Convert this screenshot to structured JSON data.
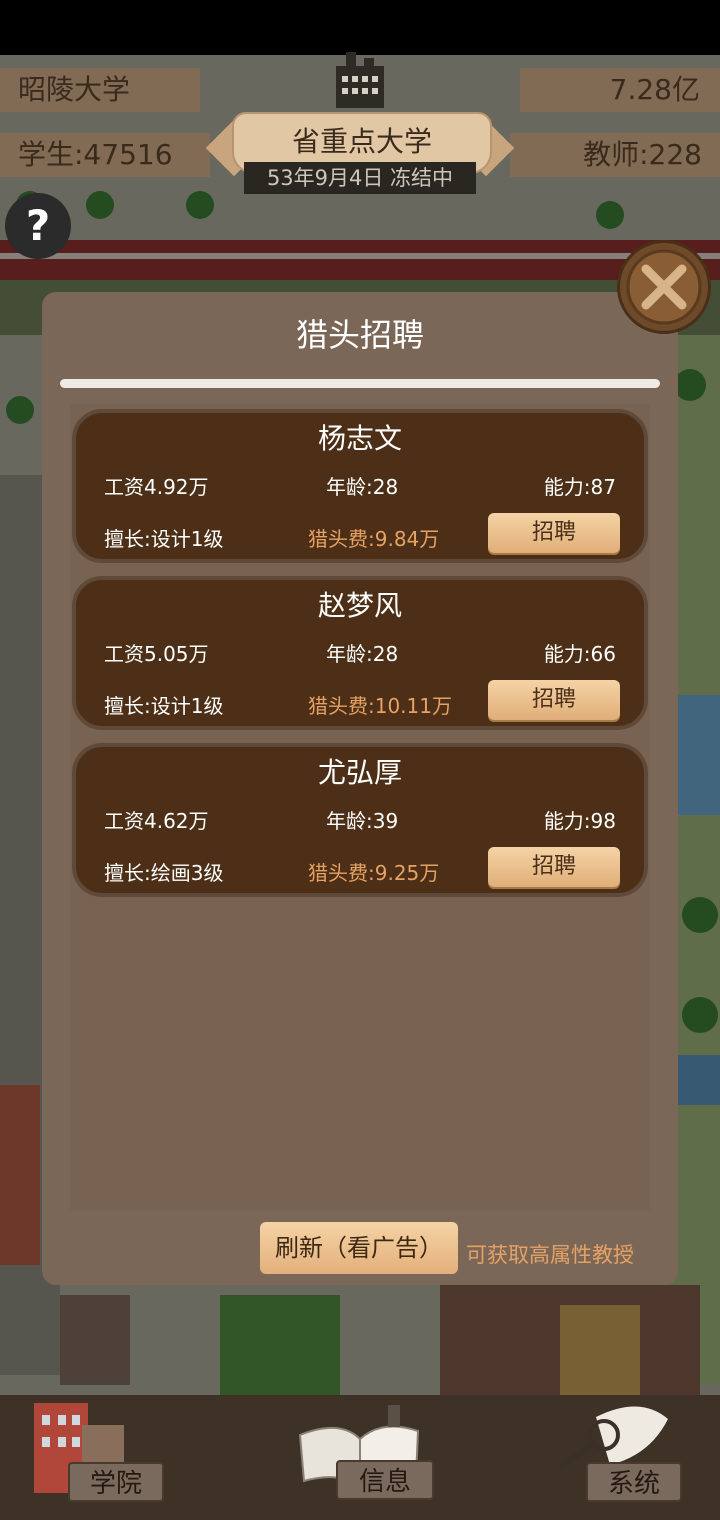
{
  "hud": {
    "school_name": "昭陵大学",
    "money": "7.28亿",
    "students": "学生:47516",
    "teachers": "教师:228",
    "rank": "省重点大学",
    "date": "53年9月4日 冻结中"
  },
  "icons": {
    "help": "?",
    "close": "X"
  },
  "modal": {
    "title": "猎头招聘",
    "candidates": [
      {
        "name": "杨志文",
        "salary": "工资4.92万",
        "age": "年龄:28",
        "ability": "能力:87",
        "skill": "擅长:设计1级",
        "fee": "猎头费:9.84万",
        "hire": "招聘"
      },
      {
        "name": "赵梦风",
        "salary": "工资5.05万",
        "age": "年龄:28",
        "ability": "能力:66",
        "skill": "擅长:设计1级",
        "fee": "猎头费:10.11万",
        "hire": "招聘"
      },
      {
        "name": "尤弘厚",
        "salary": "工资4.62万",
        "age": "年龄:39",
        "ability": "能力:98",
        "skill": "擅长:绘画3级",
        "fee": "猎头费:9.25万",
        "hire": "招聘"
      }
    ],
    "refresh_label": "刷新（看广告）",
    "refresh_hint": "可获取高属性教授"
  },
  "nav": {
    "college": "学院",
    "info": "信息",
    "system": "系统"
  },
  "colors": {
    "modal_bg": "#7b6757",
    "card_bg": "#4c2f16",
    "accent_orange": "#e6a264",
    "button_light": "#f5d3a5"
  }
}
